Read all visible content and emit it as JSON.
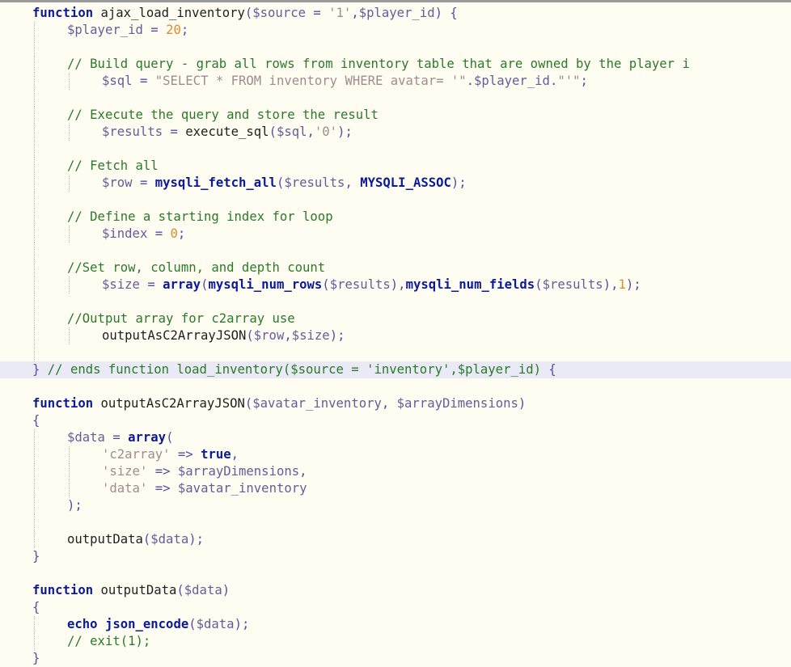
{
  "editor": {
    "lines": [
      {
        "indent": 0,
        "tokens": [
          {
            "t": "kw",
            "v": "function"
          },
          {
            "t": "fn",
            "v": " ajax_load_inventory"
          },
          {
            "t": "op",
            "v": "("
          },
          {
            "t": "var",
            "v": "$source"
          },
          {
            "t": "op",
            "v": " = "
          },
          {
            "t": "str",
            "v": "'1'"
          },
          {
            "t": "op",
            "v": ","
          },
          {
            "t": "var",
            "v": "$player_id"
          },
          {
            "t": "op",
            "v": ") {"
          }
        ]
      },
      {
        "indent": 1,
        "tokens": [
          {
            "t": "var",
            "v": "$player_id"
          },
          {
            "t": "op",
            "v": " = "
          },
          {
            "t": "num",
            "v": "20"
          },
          {
            "t": "op",
            "v": ";"
          }
        ]
      },
      {
        "indent": 1,
        "tokens": []
      },
      {
        "indent": 1,
        "tokens": [
          {
            "t": "cm",
            "v": "// Build query - grab all rows from inventory table that are owned by the player i"
          }
        ]
      },
      {
        "indent": 2,
        "tokens": [
          {
            "t": "var",
            "v": "$sql"
          },
          {
            "t": "op",
            "v": " = "
          },
          {
            "t": "str",
            "v": "\"SELECT * FROM inventory WHERE avatar= '\""
          },
          {
            "t": "op",
            "v": "."
          },
          {
            "t": "var",
            "v": "$player_id"
          },
          {
            "t": "op",
            "v": "."
          },
          {
            "t": "str",
            "v": "\"'\""
          },
          {
            "t": "op",
            "v": ";"
          }
        ]
      },
      {
        "indent": 1,
        "tokens": []
      },
      {
        "indent": 1,
        "tokens": [
          {
            "t": "cm",
            "v": "// Execute the query and store the result"
          }
        ]
      },
      {
        "indent": 2,
        "tokens": [
          {
            "t": "var",
            "v": "$results"
          },
          {
            "t": "op",
            "v": " = "
          },
          {
            "t": "fn",
            "v": "execute_sql"
          },
          {
            "t": "op",
            "v": "("
          },
          {
            "t": "var",
            "v": "$sql"
          },
          {
            "t": "op",
            "v": ","
          },
          {
            "t": "str",
            "v": "'0'"
          },
          {
            "t": "op",
            "v": ");"
          }
        ]
      },
      {
        "indent": 1,
        "tokens": []
      },
      {
        "indent": 1,
        "tokens": [
          {
            "t": "cm",
            "v": "// Fetch all"
          }
        ]
      },
      {
        "indent": 2,
        "tokens": [
          {
            "t": "var",
            "v": "$row"
          },
          {
            "t": "op",
            "v": " = "
          },
          {
            "t": "kw",
            "v": "mysqli_fetch_all"
          },
          {
            "t": "op",
            "v": "("
          },
          {
            "t": "var",
            "v": "$results"
          },
          {
            "t": "op",
            "v": ", "
          },
          {
            "t": "kw",
            "v": "MYSQLI_ASSOC"
          },
          {
            "t": "op",
            "v": ");"
          }
        ]
      },
      {
        "indent": 1,
        "tokens": []
      },
      {
        "indent": 1,
        "tokens": [
          {
            "t": "cm",
            "v": "// Define a starting index for loop"
          }
        ]
      },
      {
        "indent": 2,
        "tokens": [
          {
            "t": "var",
            "v": "$index"
          },
          {
            "t": "op",
            "v": " = "
          },
          {
            "t": "num",
            "v": "0"
          },
          {
            "t": "op",
            "v": ";"
          }
        ]
      },
      {
        "indent": 1,
        "tokens": []
      },
      {
        "indent": 1,
        "tokens": [
          {
            "t": "cm",
            "v": "//Set row, column, and depth count"
          }
        ]
      },
      {
        "indent": 2,
        "tokens": [
          {
            "t": "var",
            "v": "$size"
          },
          {
            "t": "op",
            "v": " = "
          },
          {
            "t": "kw",
            "v": "array"
          },
          {
            "t": "op",
            "v": "("
          },
          {
            "t": "kw",
            "v": "mysqli_num_rows"
          },
          {
            "t": "op",
            "v": "("
          },
          {
            "t": "var",
            "v": "$results"
          },
          {
            "t": "op",
            "v": "),"
          },
          {
            "t": "kw",
            "v": "mysqli_num_fields"
          },
          {
            "t": "op",
            "v": "("
          },
          {
            "t": "var",
            "v": "$results"
          },
          {
            "t": "op",
            "v": "),"
          },
          {
            "t": "num",
            "v": "1"
          },
          {
            "t": "op",
            "v": ");"
          }
        ]
      },
      {
        "indent": 1,
        "tokens": []
      },
      {
        "indent": 1,
        "tokens": [
          {
            "t": "cm",
            "v": "//Output array for c2array use"
          }
        ]
      },
      {
        "indent": 2,
        "tokens": [
          {
            "t": "fn",
            "v": "outputAsC2ArrayJSON"
          },
          {
            "t": "op",
            "v": "("
          },
          {
            "t": "var",
            "v": "$row"
          },
          {
            "t": "op",
            "v": ","
          },
          {
            "t": "var",
            "v": "$size"
          },
          {
            "t": "op",
            "v": ");"
          }
        ]
      },
      {
        "indent": 1,
        "tokens": []
      },
      {
        "indent": 0,
        "current": true,
        "tokens": [
          {
            "t": "op",
            "v": "} "
          },
          {
            "t": "cm",
            "v": "// ends function load_inventory($source = 'inventory',$player_id) "
          },
          {
            "t": "op",
            "v": "{"
          }
        ]
      },
      {
        "indent": 0,
        "tokens": []
      },
      {
        "indent": 0,
        "tokens": [
          {
            "t": "kw",
            "v": "function"
          },
          {
            "t": "fn",
            "v": " outputAsC2ArrayJSON"
          },
          {
            "t": "op",
            "v": "("
          },
          {
            "t": "var",
            "v": "$avatar_inventory"
          },
          {
            "t": "op",
            "v": ", "
          },
          {
            "t": "var",
            "v": "$arrayDimensions"
          },
          {
            "t": "op",
            "v": ")"
          }
        ]
      },
      {
        "indent": 0,
        "tokens": [
          {
            "t": "op",
            "v": "{"
          }
        ]
      },
      {
        "indent": 1,
        "tokens": [
          {
            "t": "var",
            "v": "$data"
          },
          {
            "t": "op",
            "v": " = "
          },
          {
            "t": "kw",
            "v": "array"
          },
          {
            "t": "op",
            "v": "("
          }
        ]
      },
      {
        "indent": 2,
        "tokens": [
          {
            "t": "str",
            "v": "'c2array'"
          },
          {
            "t": "op",
            "v": " => "
          },
          {
            "t": "kw",
            "v": "true"
          },
          {
            "t": "op",
            "v": ","
          }
        ]
      },
      {
        "indent": 2,
        "tokens": [
          {
            "t": "str",
            "v": "'size'"
          },
          {
            "t": "op",
            "v": " => "
          },
          {
            "t": "var",
            "v": "$arrayDimensions"
          },
          {
            "t": "op",
            "v": ","
          }
        ]
      },
      {
        "indent": 2,
        "tokens": [
          {
            "t": "str",
            "v": "'data'"
          },
          {
            "t": "op",
            "v": " => "
          },
          {
            "t": "var",
            "v": "$avatar_inventory"
          }
        ]
      },
      {
        "indent": 1,
        "tokens": [
          {
            "t": "op",
            "v": ");"
          }
        ]
      },
      {
        "indent": 1,
        "tokens": []
      },
      {
        "indent": 1,
        "tokens": [
          {
            "t": "fn",
            "v": "outputData"
          },
          {
            "t": "op",
            "v": "("
          },
          {
            "t": "var",
            "v": "$data"
          },
          {
            "t": "op",
            "v": ");"
          }
        ]
      },
      {
        "indent": 0,
        "tokens": [
          {
            "t": "op",
            "v": "}"
          }
        ]
      },
      {
        "indent": 0,
        "tokens": []
      },
      {
        "indent": 0,
        "tokens": [
          {
            "t": "kw",
            "v": "function"
          },
          {
            "t": "fn",
            "v": " outputData"
          },
          {
            "t": "op",
            "v": "("
          },
          {
            "t": "var",
            "v": "$data"
          },
          {
            "t": "op",
            "v": ")"
          }
        ]
      },
      {
        "indent": 0,
        "tokens": [
          {
            "t": "op",
            "v": "{"
          }
        ]
      },
      {
        "indent": 1,
        "tokens": [
          {
            "t": "kw",
            "v": "echo"
          },
          {
            "t": "op",
            "v": " "
          },
          {
            "t": "kw",
            "v": "json_encode"
          },
          {
            "t": "op",
            "v": "("
          },
          {
            "t": "var",
            "v": "$data"
          },
          {
            "t": "op",
            "v": ");"
          }
        ]
      },
      {
        "indent": 1,
        "tokens": [
          {
            "t": "cm",
            "v": "// exit(1);"
          }
        ]
      },
      {
        "indent": 0,
        "tokens": [
          {
            "t": "op",
            "v": "}"
          }
        ]
      }
    ]
  }
}
